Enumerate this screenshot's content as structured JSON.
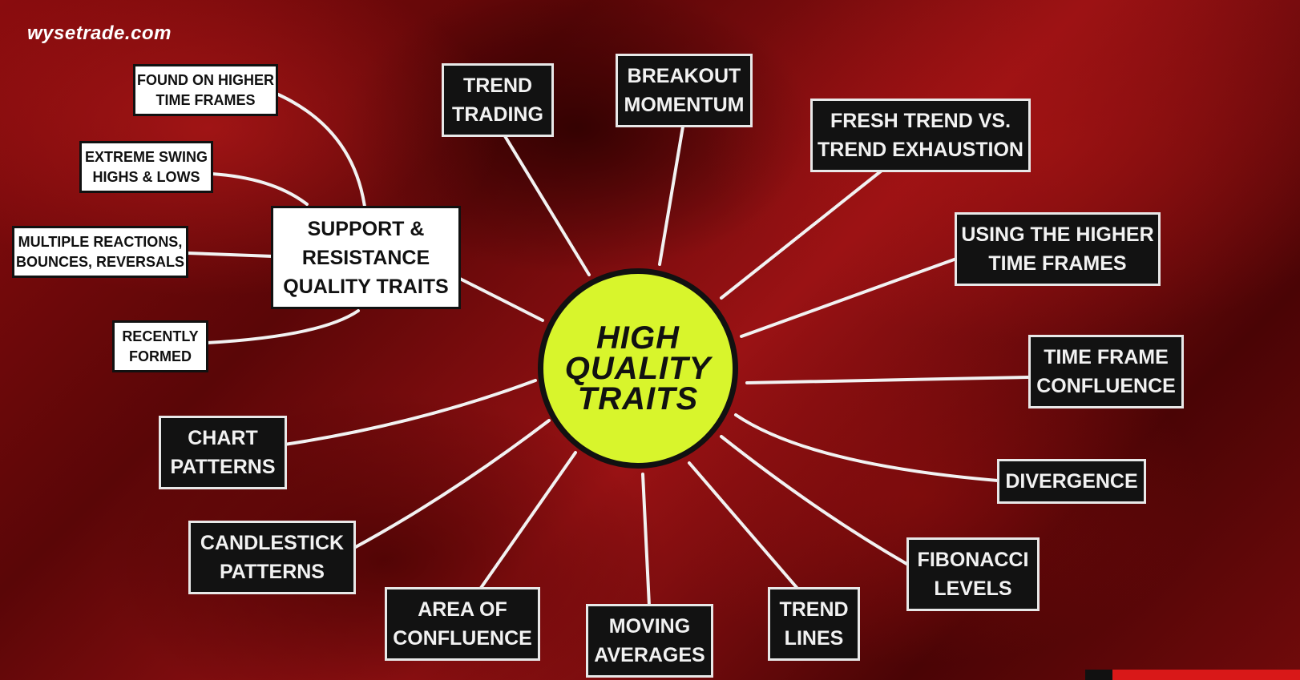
{
  "site": {
    "logo_text": "wysetrade.com"
  },
  "diagram": {
    "hub": {
      "label": "HIGH\nQUALITY\nTRAITS",
      "color": "#d8f52c"
    },
    "nodes": [
      {
        "id": "support-resistance",
        "label": "SUPPORT &\nRESISTANCE\nQUALITY TRAITS"
      },
      {
        "id": "trend-trading",
        "label": "TREND\nTRADING"
      },
      {
        "id": "breakout-momentum",
        "label": "BREAKOUT\nMOMENTUM"
      },
      {
        "id": "fresh-trend",
        "label": "FRESH TREND VS.\nTREND EXHAUSTION"
      },
      {
        "id": "higher-time-frames",
        "label": "USING THE HIGHER\nTIME FRAMES"
      },
      {
        "id": "time-frame-confluence",
        "label": "TIME FRAME\nCONFLUENCE"
      },
      {
        "id": "divergence",
        "label": "DIVERGENCE"
      },
      {
        "id": "fibonacci",
        "label": "FIBONACCI\nLEVELS"
      },
      {
        "id": "trend-lines",
        "label": "TREND\nLINES"
      },
      {
        "id": "moving-averages",
        "label": "MOVING\nAVERAGES"
      },
      {
        "id": "area-of-confluence",
        "label": "AREA OF\nCONFLUENCE"
      },
      {
        "id": "candlestick-patterns",
        "label": "CANDLESTICK\nPATTERNS"
      },
      {
        "id": "chart-patterns",
        "label": "CHART\nPATTERNS"
      }
    ],
    "sub_nodes": [
      {
        "id": "found-higher",
        "label": "FOUND ON HIGHER\nTIME FRAMES"
      },
      {
        "id": "extreme-swing",
        "label": "EXTREME SWING\nHIGHS & LOWS"
      },
      {
        "id": "multiple-reactions",
        "label": "MULTIPLE REACTIONS,\nBOUNCES, REVERSALS"
      },
      {
        "id": "recently-formed",
        "label": "RECENTLY\nFORMED"
      }
    ],
    "colors": {
      "connector": "#f2f2f2",
      "dark_box": "#121212",
      "light_box": "#ffffff",
      "accent_red": "#d91818"
    }
  }
}
